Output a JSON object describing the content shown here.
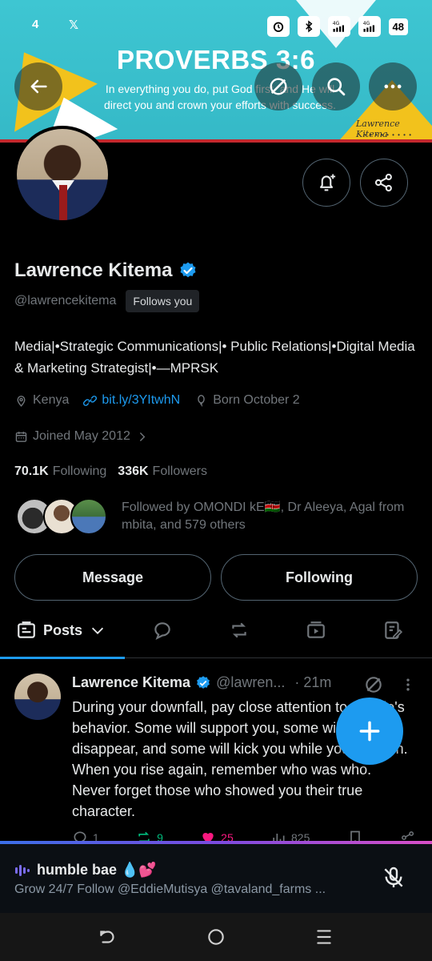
{
  "status_bar": {
    "time": "4",
    "x_logo": "𝕏",
    "battery": "48",
    "net1": "4G",
    "net2": "4G"
  },
  "banner": {
    "title": "PROVERBS 3:6",
    "subtitle": "In everything you do, put God first, and He will direct you and crown your efforts with success.",
    "signature": "Lawrence Kitema",
    "dots": "• • • • • • • • •"
  },
  "profile": {
    "name": "Lawrence Kitema",
    "handle": "@lawrencekitema",
    "follows_you": "Follows you",
    "bio": "Media|•Strategic Communications|• Public Relations|•Digital Media & Marketing Strategist|•—MPRSK",
    "location": "Kenya",
    "link": "bit.ly/3YItwhN",
    "birthday": "Born October 2",
    "joined": "Joined May 2012",
    "following_count": "70.1K",
    "following_label": "Following",
    "followers_count": "336K",
    "followers_label": "Followers",
    "followed_by": "Followed by OMONDI kE🇰🇪, Dr Aleeya, Agal from mbita, and 579 others"
  },
  "buttons": {
    "message": "Message",
    "following": "Following"
  },
  "tabs": {
    "posts": "Posts"
  },
  "tweet": {
    "name": "Lawrence Kitema",
    "handle": "@lawren...",
    "time": "· 21m",
    "text": "During your downfall, pay close attention to people's behavior. Some will support you, some will disappear, and some will kick you while you're down. When you rise again, remember who was who. Never forget those who showed you their true character.",
    "replies": "1",
    "reposts": "9",
    "likes": "25",
    "views": "825"
  },
  "space": {
    "title": "humble bae 💧💕",
    "subtitle": "Grow 24/7 Follow  @EddieMutisya @tavaland_farms ..."
  },
  "colors": {
    "accent": "#1d9bf0",
    "background": "#000000",
    "muted": "#71767b",
    "like": "#f91880",
    "repost": "#00ba7c"
  }
}
